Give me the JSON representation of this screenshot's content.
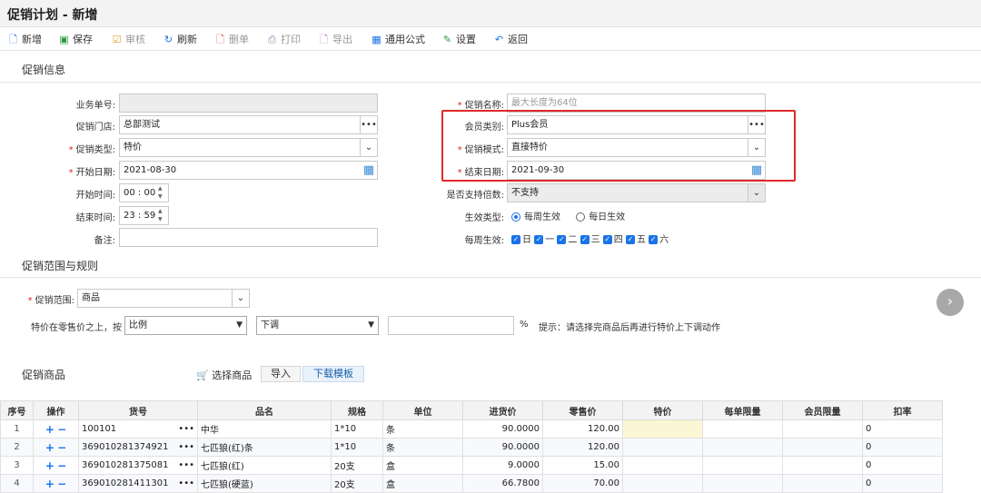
{
  "window": {
    "title": "促销计划 - 新增"
  },
  "toolbar": [
    {
      "label": "新增",
      "icon": "new-doc-icon",
      "disabled": false
    },
    {
      "label": "保存",
      "icon": "save-icon",
      "disabled": false
    },
    {
      "label": "审核",
      "icon": "audit-icon",
      "disabled": true
    },
    {
      "label": "刷新",
      "icon": "refresh-icon",
      "disabled": false
    },
    {
      "label": "删单",
      "icon": "delete-doc-icon",
      "disabled": true
    },
    {
      "label": "打印",
      "icon": "print-icon",
      "disabled": true
    },
    {
      "label": "导出",
      "icon": "export-icon",
      "disabled": true
    },
    {
      "label": "通用公式",
      "icon": "formula-icon",
      "disabled": false
    },
    {
      "label": "设置",
      "icon": "settings-icon",
      "disabled": false
    },
    {
      "label": "返回",
      "icon": "back-icon",
      "disabled": false
    }
  ],
  "promo_info": {
    "section_title": "促销信息",
    "order_no": {
      "label": "业务单号:",
      "value": ""
    },
    "store": {
      "label": "促销门店:",
      "value": "总部测试"
    },
    "promo_type": {
      "label": "促销类型:",
      "value": "特价"
    },
    "start_date": {
      "label": "开始日期:",
      "value": "2021-08-30"
    },
    "start_time": {
      "label": "开始时间:",
      "value": "00 : 00"
    },
    "end_time": {
      "label": "结束时间:",
      "value": "23 : 59"
    },
    "remark": {
      "label": "备注:",
      "value": ""
    },
    "promo_name": {
      "label": "促销名称:",
      "placeholder": "最大长度为64位"
    },
    "member_type": {
      "label": "会员类别:",
      "value": "Plus会员"
    },
    "promo_mode": {
      "label": "促销模式:",
      "value": "直接特价"
    },
    "end_date": {
      "label": "结束日期:",
      "value": "2021-09-30"
    },
    "multiple_support": {
      "label": "是否支持倍数:",
      "value": "不支持"
    },
    "effect_type": {
      "label": "生效类型:",
      "options": [
        "每周生效",
        "每日生效"
      ],
      "selected": "每周生效"
    },
    "weekly_effect": {
      "label": "每周生效:",
      "days": [
        "日",
        "一",
        "二",
        "三",
        "四",
        "五",
        "六"
      ]
    }
  },
  "scope": {
    "section_title": "促销范围与规则",
    "range": {
      "label": "促销范围:",
      "value": "商品"
    },
    "rule_label": "特价在零售价之上，按",
    "rule_basis": "比例",
    "rule_direction": "下调",
    "rule_value": "",
    "percent_sign": "%",
    "tip": "提示：请选择完商品后再进行特价上下调动作"
  },
  "goods": {
    "section_title": "促销商品",
    "select_label": "选择商品",
    "import_label": "导入",
    "template_label": "下载模板",
    "columns": [
      "序号",
      "操作",
      "货号",
      "品名",
      "规格",
      "单位",
      "进货价",
      "零售价",
      "特价",
      "每单限量",
      "会员限量",
      "扣率"
    ],
    "rows": [
      {
        "no": "1",
        "code": "100101",
        "name": "中华",
        "spec": "1*10",
        "unit": "条",
        "cost": "90.0000",
        "retail": "120.00",
        "special": "",
        "per_order": "",
        "member_limit": "",
        "rate": "0"
      },
      {
        "no": "2",
        "code": "369010281374921",
        "name": "七匹狼(红)条",
        "spec": "1*10",
        "unit": "条",
        "cost": "90.0000",
        "retail": "120.00",
        "special": "",
        "per_order": "",
        "member_limit": "",
        "rate": "0"
      },
      {
        "no": "3",
        "code": "369010281375081",
        "name": "七匹狼(红)",
        "spec": "20支",
        "unit": "盒",
        "cost": "9.0000",
        "retail": "15.00",
        "special": "",
        "per_order": "",
        "member_limit": "",
        "rate": "0"
      },
      {
        "no": "4",
        "code": "369010281411301",
        "name": "七匹狼(硬蓝)",
        "spec": "20支",
        "unit": "盒",
        "cost": "66.7800",
        "retail": "70.00",
        "special": "",
        "per_order": "",
        "member_limit": "",
        "rate": "0"
      }
    ]
  },
  "colors": {
    "accent": "#1a73e8",
    "required": "#e02020",
    "highlight_box": "#e02828"
  }
}
